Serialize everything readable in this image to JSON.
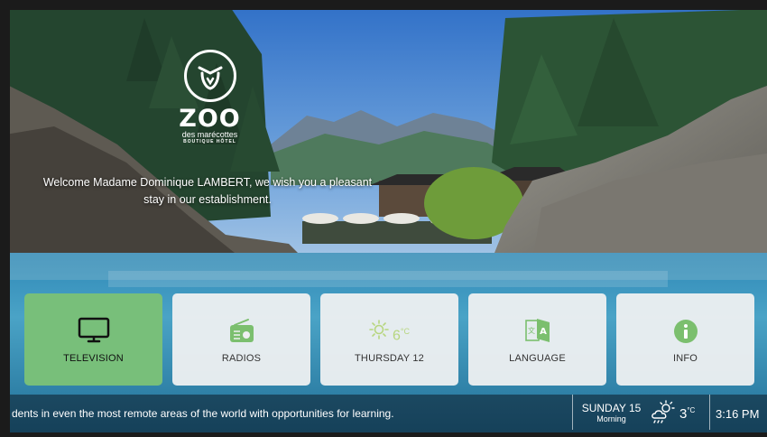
{
  "hotel": {
    "name": "ZOO",
    "subtitle": "des marécottes",
    "tagline": "BOUTIQUE HÔTEL"
  },
  "welcome_message": "Welcome Madame Dominique LAMBERT, we wish you a pleasant stay in our establishment.",
  "tiles": [
    {
      "label": "TELEVISION",
      "icon": "tv-icon",
      "active": true
    },
    {
      "label": "RADIOS",
      "icon": "radio-icon",
      "active": false
    },
    {
      "label": "THURSDAY 12",
      "icon": "sun-icon",
      "temperature": "6",
      "unit": "°C",
      "active": false
    },
    {
      "label": "LANGUAGE",
      "icon": "language-icon",
      "active": false
    },
    {
      "label": "INFO",
      "icon": "info-icon",
      "active": false
    }
  ],
  "status_bar": {
    "ticker": "dents in even the most remote areas of the world with opportunities for learning.",
    "date": "SUNDAY 15",
    "period": "Morning",
    "weather_icon": "partly-cloudy-icon",
    "temperature": "3",
    "unit": "°C",
    "time": "3:16 PM"
  },
  "colors": {
    "active_tile": "#78bf7a",
    "tile": "#eef0f1",
    "icon_green": "#7bbf6e",
    "weather_text": "#b7d67f"
  }
}
